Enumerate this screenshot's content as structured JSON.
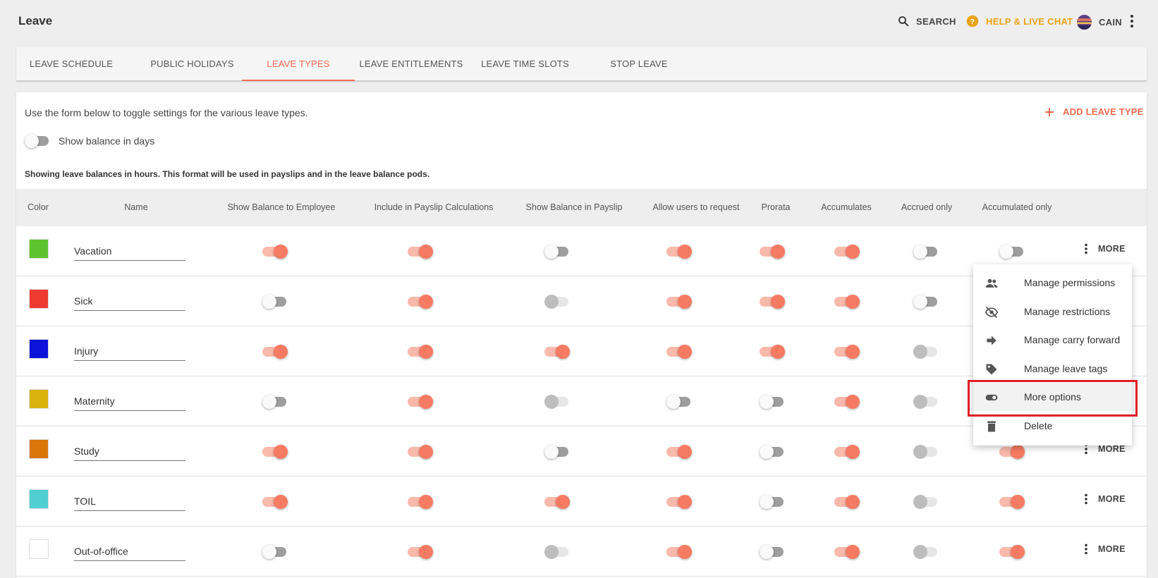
{
  "header": {
    "title": "Leave",
    "search_label": "SEARCH",
    "help_label": "HELP & LIVE CHAT",
    "user_label": "CAIN"
  },
  "tabs": [
    {
      "label": "LEAVE SCHEDULE",
      "active": false
    },
    {
      "label": "PUBLIC HOLIDAYS",
      "active": false
    },
    {
      "label": "LEAVE TYPES",
      "active": true
    },
    {
      "label": "LEAVE ENTITLEMENTS",
      "active": false
    },
    {
      "label": "LEAVE TIME SLOTS",
      "active": false
    },
    {
      "label": "STOP LEAVE",
      "active": false
    }
  ],
  "card": {
    "intro": "Use the form below to toggle settings for the various leave types.",
    "add_label": "ADD LEAVE TYPE",
    "show_days_label": "Show balance in days",
    "note": "Showing leave balances in hours. This format will be used in payslips and in the leave balance pods."
  },
  "columns": [
    "Color",
    "Name",
    "Show Balance to Employee",
    "Include in Payslip Calculations",
    "Show Balance in Payslip",
    "Allow users to request",
    "Prorata",
    "Accumulates",
    "Accrued only",
    "Accumulated only"
  ],
  "more_label": "MORE",
  "rows": [
    {
      "color": "#5dc42f",
      "name": "Vacation",
      "toggles": [
        "on",
        "on",
        "off",
        "on",
        "on",
        "on",
        "off",
        "off"
      ]
    },
    {
      "color": "#ef3a31",
      "name": "Sick",
      "toggles": [
        "off",
        "on",
        "dis",
        "on",
        "on",
        "on",
        "off",
        "on"
      ]
    },
    {
      "color": "#0d12d9",
      "name": "Injury",
      "toggles": [
        "on",
        "on",
        "on",
        "on",
        "on",
        "on",
        "dis",
        "on"
      ]
    },
    {
      "color": "#d8b40c",
      "name": "Maternity",
      "toggles": [
        "off",
        "on",
        "dis",
        "off",
        "off",
        "on",
        "dis",
        "on"
      ]
    },
    {
      "color": "#d97509",
      "name": "Study",
      "toggles": [
        "on",
        "on",
        "off",
        "on",
        "off",
        "on",
        "dis",
        "on"
      ]
    },
    {
      "color": "#4fcfcf",
      "name": "TOIL",
      "toggles": [
        "on",
        "on",
        "on",
        "on",
        "off",
        "on",
        "dis",
        "on"
      ]
    },
    {
      "color": "#ffffff",
      "name": "Out-of-office",
      "toggles": [
        "off",
        "on",
        "dis",
        "on",
        "off",
        "on",
        "dis",
        "on"
      ]
    }
  ],
  "menu": {
    "items": [
      {
        "label": "Manage permissions",
        "icon": "people-icon"
      },
      {
        "label": "Manage restrictions",
        "icon": "eye-off-icon"
      },
      {
        "label": "Manage carry forward",
        "icon": "arrow-right-icon"
      },
      {
        "label": "Manage leave tags",
        "icon": "tag-icon"
      },
      {
        "label": "More options",
        "icon": "toggle-icon",
        "highlighted": true
      },
      {
        "label": "Delete",
        "icon": "trash-icon"
      }
    ]
  },
  "colors": {
    "accent": "#f26b4f",
    "help": "#e8a317",
    "highlight_box": "#e01f26"
  }
}
